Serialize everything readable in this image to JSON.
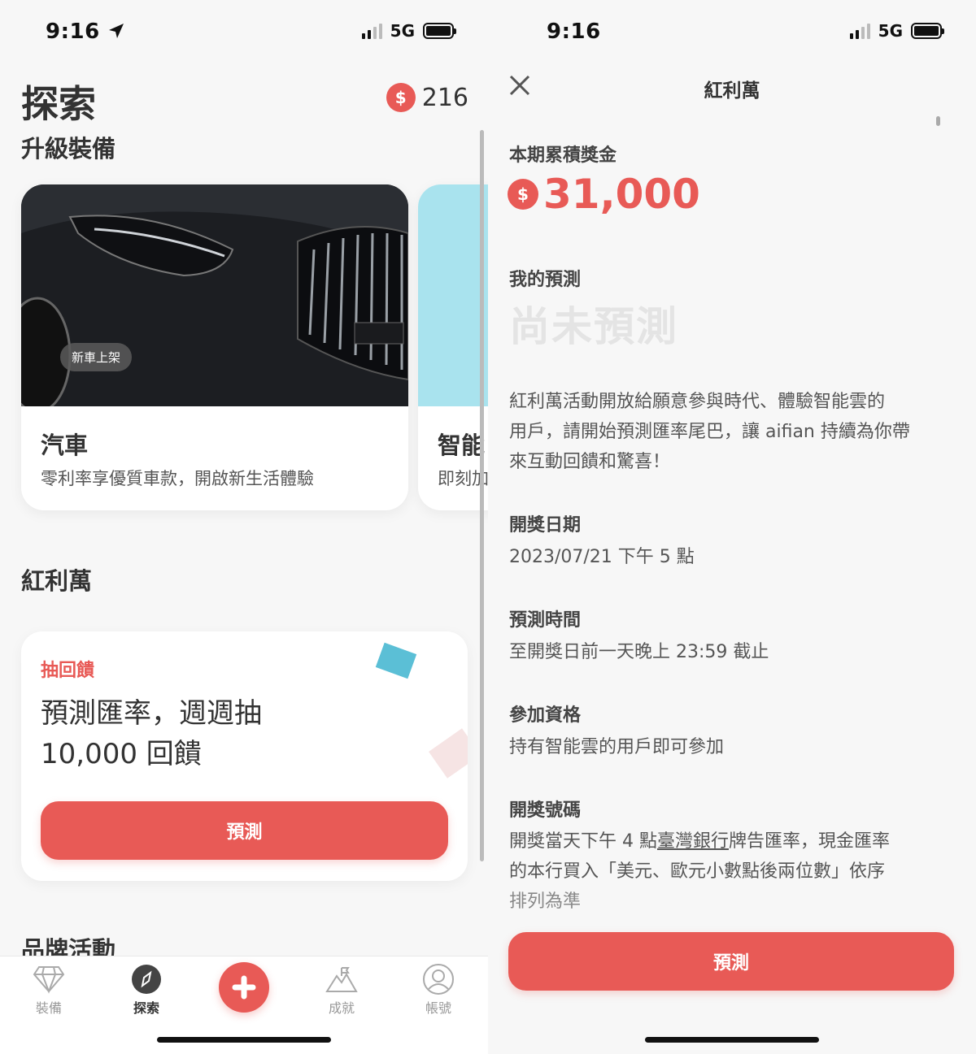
{
  "status_left": {
    "time": "9:16",
    "network": "5G"
  },
  "status_right": {
    "time": "9:16",
    "network": "5G"
  },
  "explore": {
    "title": "探索",
    "coins": "216",
    "coin_symbol": "$",
    "section_upgrade": "升級裝備",
    "car_card": {
      "badge": "新車上架",
      "title": "汽車",
      "subtitle": "零利率享優質車款，開啟新生活體驗"
    },
    "peek_card": {
      "title": "智能",
      "subtitle": "即刻加"
    },
    "section_bonus": "紅利萬",
    "bonus_card": {
      "tag": "抽回饋",
      "line1": "預測匯率，週週抽",
      "line2": "10,000 回饋",
      "button": "預測"
    },
    "section_brand": "品牌活動",
    "tabs": [
      {
        "label": "裝備",
        "icon": "diamond-icon"
      },
      {
        "label": "探索",
        "icon": "compass-icon"
      },
      {
        "label": "成就",
        "icon": "mountain-flag-icon"
      },
      {
        "label": "帳號",
        "icon": "user-icon"
      }
    ],
    "fab_icon": "plus-icon"
  },
  "detail": {
    "title": "紅利萬",
    "pool_label": "本期累積獎金",
    "pool_amount": "31,000",
    "coin_symbol": "$",
    "my_pred_label": "我的預測",
    "my_pred_value": "尚未預測",
    "intro_line1": "紅利萬活動開放給願意參與時代、體驗智能雲的",
    "intro_line2": "用戶，請開始預測匯率尾巴，讓 aifian 持續為你帶",
    "intro_line3": "來互動回饋和驚喜！",
    "draw_date_label": "開獎日期",
    "draw_date_value": "2023/07/21 下午 5 點",
    "pred_time_label": "預測時間",
    "pred_time_value": "至開獎日前一天晚上 23:59 截止",
    "eligibility_label": "參加資格",
    "eligibility_value": "持有智能雲的用戶即可參加",
    "number_label": "開獎號碼",
    "number_line1_a": "開獎當天下午 4 點",
    "number_line1_link": "臺灣銀行",
    "number_line1_b": "牌告匯率，現金匯率",
    "number_line2": "的本行買入「美元、歐元小數點後兩位數」依序",
    "number_line3": "排列為準",
    "button": "預測"
  },
  "colors": {
    "accent": "#e85a56",
    "teal": "#5bbfd6"
  }
}
